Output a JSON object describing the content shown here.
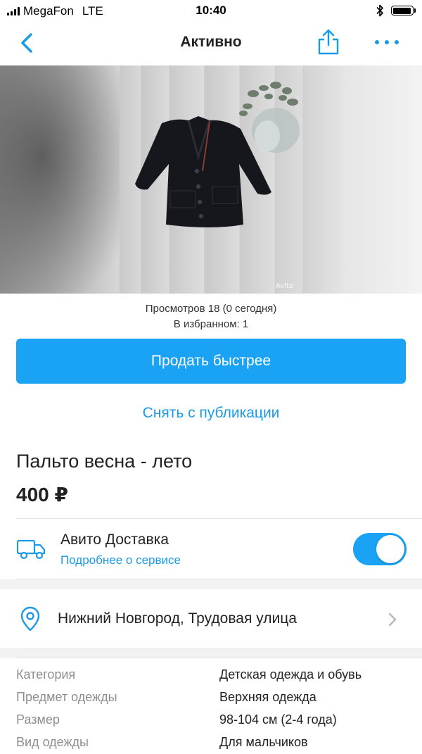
{
  "status_bar": {
    "carrier": "MegaFon",
    "network": "LTE",
    "time": "10:40",
    "battery_level": 0.95,
    "icons": [
      "signal-bars-icon",
      "bluetooth-icon",
      "battery-icon"
    ]
  },
  "nav": {
    "title": "Активно",
    "icons": [
      "back-chevron-icon",
      "share-icon",
      "more-dots-icon"
    ],
    "accent_color": "#1a9ae6"
  },
  "gallery": {
    "photo_subject": "black-coat-on-wooden-floor",
    "watermark": "Avito"
  },
  "stats": {
    "views": "Просмотров 18 (0 сегодня)",
    "favorites": "В избранном: 1"
  },
  "actions": {
    "sell_faster": "Продать быстрее",
    "unpublish": "Снять с публикации",
    "primary_color": "#1aa3f5"
  },
  "listing": {
    "title": "Пальто весна - лето",
    "price": "400 ₽"
  },
  "delivery": {
    "icon": "truck-icon",
    "title": "Авито Доставка",
    "link": "Подробнее о сервисе",
    "enabled": true
  },
  "location": {
    "icon": "location-pin-icon",
    "address": "Нижний Новгород, Трудовая улица"
  },
  "params": [
    {
      "key": "Категория",
      "value": "Детская одежда и обувь"
    },
    {
      "key": "Предмет одежды",
      "value": "Верхняя одежда"
    },
    {
      "key": "Размер",
      "value": "98-104 см (2-4 года)"
    },
    {
      "key": "Вид одежды",
      "value": "Для мальчиков"
    }
  ]
}
